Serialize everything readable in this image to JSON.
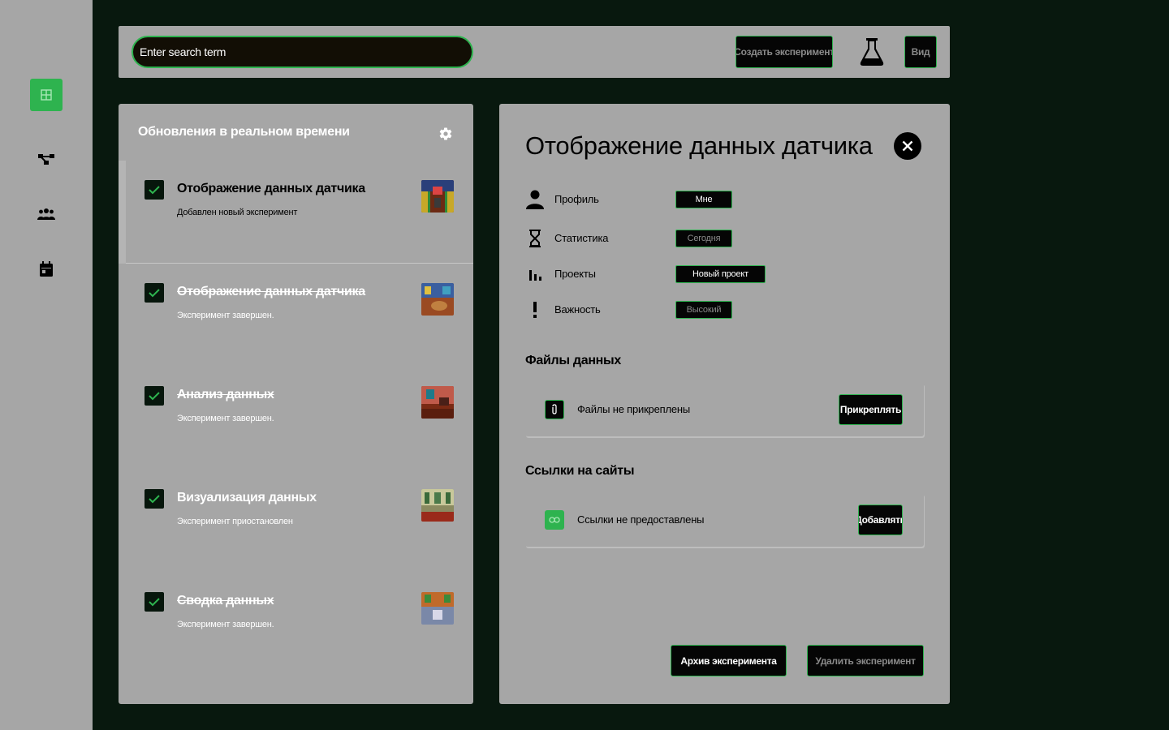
{
  "sidebar": {
    "items": [
      {
        "icon": "dashboard-icon",
        "active": true
      },
      {
        "icon": "network-icon",
        "active": false
      },
      {
        "icon": "team-icon",
        "active": false
      },
      {
        "icon": "calendar-icon",
        "active": false
      }
    ]
  },
  "topbar": {
    "search_value": "Enter search term",
    "create_label": "Создать эксперимент",
    "view_label": "Вид"
  },
  "updates": {
    "title": "Обновления в реальном времени",
    "items": [
      {
        "title": "Отображение данных датчика",
        "subtitle": "Добавлен новый эксперимент",
        "checked": true,
        "struck": false
      },
      {
        "title": "Отображение данных датчика",
        "subtitle": "Эксперимент завершен.",
        "checked": true,
        "struck": true
      },
      {
        "title": "Анализ данных",
        "subtitle": "Эксперимент завершен.",
        "checked": true,
        "struck": true
      },
      {
        "title": "Визуализация данных",
        "subtitle": "Эксперимент приостановлен",
        "checked": true,
        "struck": false
      },
      {
        "title": "Сводка данных",
        "subtitle": "Эксперимент завершен.",
        "checked": true,
        "struck": true
      }
    ]
  },
  "detail": {
    "title": "Отображение данных датчика",
    "meta": [
      {
        "label": "Профиль",
        "value": "Мне",
        "icon": "person-icon"
      },
      {
        "label": "Статистика",
        "value": "Сегодня",
        "icon": "hourglass-icon"
      },
      {
        "label": "Проекты",
        "value": "Новый проект",
        "icon": "bar-chart-icon"
      },
      {
        "label": "Важность",
        "value": "Высокий",
        "icon": "exclamation-icon"
      }
    ],
    "files_heading": "Файлы данных",
    "files_empty": "Файлы не прикреплены",
    "attach_label": "Прикреплять",
    "links_heading": "Ссылки на сайты",
    "links_empty": "Ссылки не предоставлены",
    "add_label": "Добавлять",
    "archive_label": "Архив эксперимента",
    "delete_label": "Удалить эксперимент"
  },
  "colors": {
    "accent": "#2eb34f",
    "background": "#08180e",
    "panel": "#a6a6a6"
  }
}
